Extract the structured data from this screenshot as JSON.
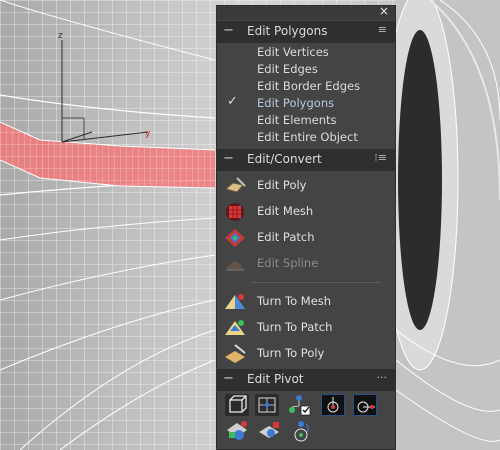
{
  "viewport": {
    "axis_labels": {
      "z": "z",
      "y": "y"
    },
    "colors": {
      "mesh_bg": "#c8c8c8",
      "wire": "#ffffff",
      "selection": "#f0787a",
      "dark_wheel": "#2a2a2a"
    }
  },
  "quad_menu": {
    "close_label": "×",
    "edit_polygons": {
      "header": "Edit Polygons",
      "items": [
        "Edit Vertices",
        "Edit Edges",
        "Edit Border Edges",
        "Edit Polygons",
        "Edit Elements",
        "Edit Entire Object"
      ],
      "checked_item": "Edit Polygons",
      "check_glyph": "✓"
    },
    "edit_convert": {
      "header": "Edit/Convert",
      "edit_items": [
        {
          "label": "Edit Poly",
          "icon": "edit-poly-icon",
          "enabled": true
        },
        {
          "label": "Edit Mesh",
          "icon": "edit-mesh-icon",
          "enabled": true
        },
        {
          "label": "Edit Patch",
          "icon": "edit-patch-icon",
          "enabled": true
        },
        {
          "label": "Edit Spline",
          "icon": "edit-spline-icon",
          "enabled": false
        }
      ],
      "turn_items": [
        {
          "label": "Turn To Mesh",
          "icon": "turn-to-mesh-icon"
        },
        {
          "label": "Turn To Patch",
          "icon": "turn-to-patch-icon"
        },
        {
          "label": "Turn To Poly",
          "icon": "turn-to-poly-icon"
        }
      ]
    },
    "edit_pivot": {
      "header": "Edit Pivot",
      "buttons": [
        "pivot-affect-object-icon",
        "pivot-affect-hierarchy-icon",
        "pivot-node-hierarchy-icon",
        "pivot-center-icon",
        "pivot-align-icon",
        "pivot-reset-icon",
        "pivot-transform-icon",
        "pivot-rotate-icon"
      ]
    }
  }
}
